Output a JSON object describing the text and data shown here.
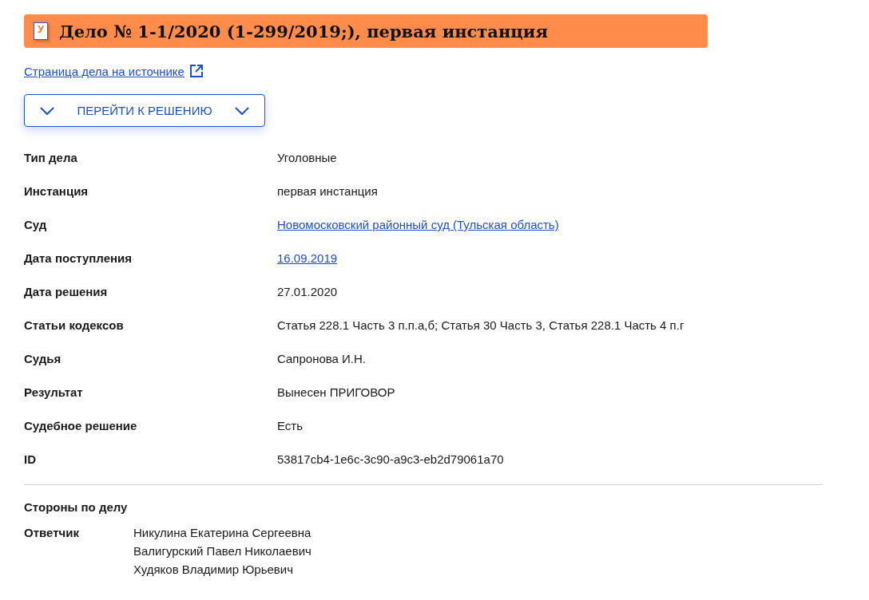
{
  "header": {
    "badge": "У",
    "title": "Дело № 1-1/2020 (1-299/2019;), первая инстанция"
  },
  "source_link": "Страница дела на источнике",
  "jump_button": "ПЕРЕЙТИ К РЕШЕНИЮ",
  "fields": [
    {
      "label": "Тип дела",
      "value": "Уголовные",
      "kind": "text"
    },
    {
      "label": "Инстанция",
      "value": "первая инстанция",
      "kind": "text"
    },
    {
      "label": "Суд",
      "value": "Новомосковский районный суд (Тульская область)",
      "kind": "link"
    },
    {
      "label": "Дата поступления",
      "value": "16.09.2019",
      "kind": "link"
    },
    {
      "label": "Дата решения",
      "value": "27.01.2020",
      "kind": "text"
    },
    {
      "label": "Статьи кодексов",
      "value": "Статья 228.1 Часть 3 п.п.а,б; Статья 30 Часть 3, Статья 228.1 Часть 4 п.г",
      "kind": "text"
    },
    {
      "label": "Судья",
      "value": "Сапронова И.Н.",
      "kind": "text"
    },
    {
      "label": "Результат",
      "value": "Вынесен ПРИГОВОР",
      "kind": "text"
    },
    {
      "label": "Судебное решение",
      "value": "Есть",
      "kind": "text"
    },
    {
      "label": "ID",
      "value": "53817cb4-1e6c-3c90-a9c3-eb2d79061a70",
      "kind": "text"
    }
  ],
  "parties": {
    "heading": "Стороны по делу",
    "groups": [
      {
        "role": "Ответчик",
        "names": [
          "Никулина Екатерина Сергеевна",
          "Валигурский Павел Николаевич",
          "Худяков Владимир Юрьевич"
        ]
      }
    ]
  }
}
